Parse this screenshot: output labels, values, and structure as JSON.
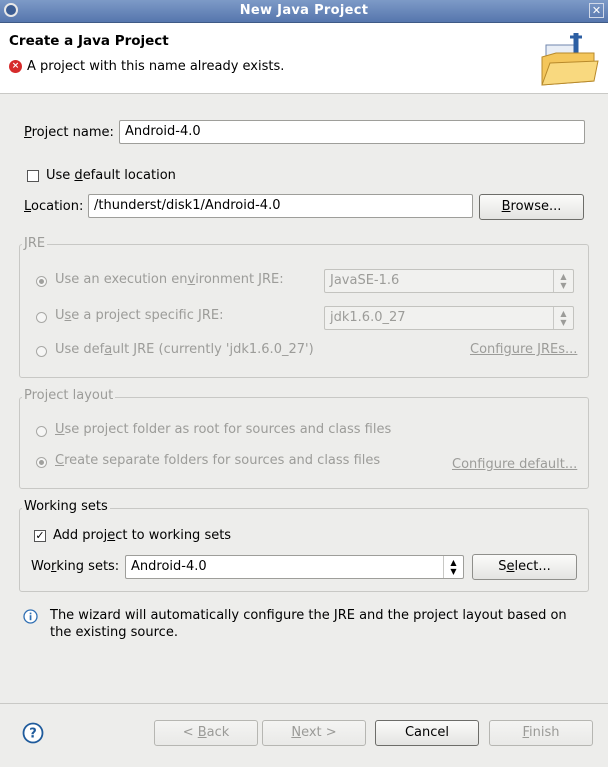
{
  "window": {
    "title": "New Java Project",
    "app_icon": "eclipse-icon",
    "close_glyph": "✕"
  },
  "header": {
    "title": "Create a Java Project",
    "error_message": "A project with this name already exists.",
    "error_icon": "error-icon"
  },
  "project_name": {
    "label_pre": "",
    "label_u": "P",
    "label_post": "roject name:",
    "value": "Android-4.0"
  },
  "default_location": {
    "label_pre": "Use ",
    "label_u": "d",
    "label_post": "efault location",
    "checked": false
  },
  "location": {
    "label_pre": "",
    "label_u": "L",
    "label_post": "ocation:",
    "value": "/thunderst/disk1/Android-4.0",
    "browse_pre": "",
    "browse_u": "B",
    "browse_post": "rowse..."
  },
  "jre": {
    "group_label": "JRE",
    "option_exec_pre": "Use an execution en",
    "option_exec_u": "v",
    "option_exec_post": "ironment JRE:",
    "exec_value": "JavaSE-1.6",
    "option_specific_pre": "U",
    "option_specific_u": "s",
    "option_specific_post": "e a project specific JRE:",
    "specific_value": "jdk1.6.0_27",
    "option_default_pre": "Use def",
    "option_default_u": "a",
    "option_default_post": "ult JRE (currently 'jdk1.6.0_27')",
    "configure_link": "Configure JREs..."
  },
  "project_layout": {
    "group_label": "Project layout",
    "option_root_pre": "",
    "option_root_u": "U",
    "option_root_post": "se project folder as root for sources and class files",
    "option_separate_pre": "",
    "option_separate_u": "C",
    "option_separate_post": "reate separate folders for sources and class files",
    "configure_link": "Configure default..."
  },
  "working_sets": {
    "group_label": "Working sets",
    "add_pre": "Add proj",
    "add_u": "e",
    "add_post": "ct to working sets",
    "add_checked": true,
    "sets_label_pre": "Wo",
    "sets_label_u": "r",
    "sets_label_post": "king sets:",
    "sets_value": "Android-4.0",
    "select_pre": "S",
    "select_u": "e",
    "select_post": "lect..."
  },
  "info": {
    "icon": "info-icon",
    "line1": "The wizard will automatically configure the JRE and the project layout based on",
    "line2": "the existing source."
  },
  "footer": {
    "help_icon": "help-icon",
    "back_pre": "< ",
    "back_u": "B",
    "back_post": "ack",
    "next_pre": "",
    "next_u": "N",
    "next_post": "ext >",
    "cancel": "Cancel",
    "finish_pre": "",
    "finish_u": "F",
    "finish_post": "inish"
  },
  "colors": {
    "titlebar": "#5d7cb1",
    "error": "#d62b2b",
    "info": "#2f6fb3"
  }
}
